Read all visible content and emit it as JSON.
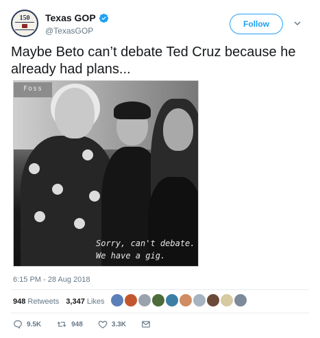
{
  "account": {
    "display_name": "Texas GOP",
    "handle": "@TexasGOP",
    "avatar_badge": "150",
    "verified": true
  },
  "follow_button": {
    "label": "Follow"
  },
  "tweet": {
    "text": "Maybe Beto can’t debate Ted Cruz because he already had plans...",
    "timestamp": "6:15 PM - 28 Aug 2018"
  },
  "media": {
    "poster_text": "Foss",
    "caption_line1": "Sorry, can't debate.",
    "caption_line2": "We have a gig."
  },
  "stats": {
    "retweets_count": "948",
    "retweets_label": "Retweets",
    "likes_count": "3,347",
    "likes_label": "Likes",
    "liker_colors": [
      "#5b7fb8",
      "#c2572e",
      "#9aa3ad",
      "#4d6b3a",
      "#3c7fa5",
      "#d08c62",
      "#a7b3c0",
      "#6b4a3a",
      "#d7c9a1",
      "#7c8a99"
    ]
  },
  "actions": {
    "replies": "9.5K",
    "retweets": "948",
    "likes": "3.3K"
  },
  "colors": {
    "brand_blue": "#1da1f2",
    "secondary_text": "#657786",
    "primary_text": "#14171a"
  }
}
